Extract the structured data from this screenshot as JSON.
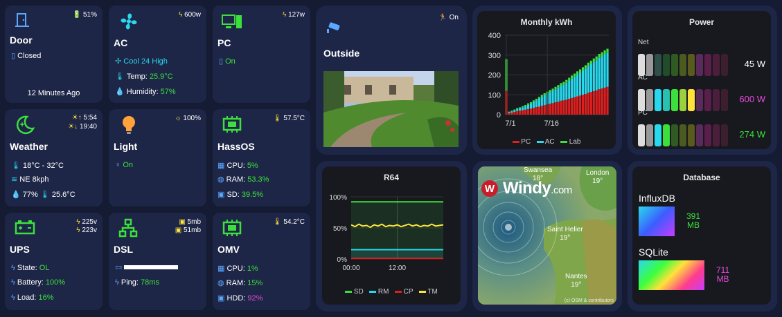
{
  "colors": {
    "bg": "#141b33",
    "card": "#1e2647",
    "green": "#3ce03c",
    "cyan": "#28d9ee",
    "magenta": "#e64bd9",
    "blue": "#5aa8ff",
    "yellow": "#ffe23a",
    "red": "#e01e1e"
  },
  "door": {
    "name": "Door",
    "battery": "51%",
    "state": "Closed",
    "ago": "12 Minutes Ago",
    "icon": "door-icon"
  },
  "ac": {
    "name": "AC",
    "power": "600w",
    "mode": "Cool 24 High",
    "temp_label": "Temp:",
    "temp": "25.9°C",
    "hum_label": "Humidity:",
    "hum": "57%",
    "icon": "fan-icon"
  },
  "pc": {
    "name": "PC",
    "power": "127w",
    "state": "On",
    "icon": "computer-icon"
  },
  "outside": {
    "name": "Outside",
    "motion": "On",
    "icon": "camera-icon"
  },
  "weather": {
    "name": "Weather",
    "sunrise": "5:54",
    "sunset": "19:40",
    "range": "18°C - 32°C",
    "wind": "NE 8kph",
    "hum": "77%",
    "dew": "25.6°C",
    "icon": "moon-star-icon"
  },
  "light": {
    "name": "Light",
    "brightness": "100%",
    "state": "On",
    "icon": "bulb-icon"
  },
  "hassos": {
    "name": "HassOS",
    "temp": "57.5°C",
    "cpu_label": "CPU:",
    "cpu": "5%",
    "ram_label": "RAM:",
    "ram": "53.3%",
    "sd_label": "SD:",
    "sd": "39.5%",
    "icon": "board-icon"
  },
  "ups": {
    "name": "UPS",
    "v1": "225v",
    "v2": "223v",
    "state_label": "State:",
    "state": "OL",
    "batt_label": "Battery:",
    "batt": "100%",
    "load_label": "Load:",
    "load": "16%",
    "icon": "battery-icon"
  },
  "dsl": {
    "name": "DSL",
    "up": "5mb",
    "down": "51mb",
    "ping_label": "Ping:",
    "ping": "78ms",
    "icon": "network-icon"
  },
  "omv": {
    "name": "OMV",
    "temp": "54.2°C",
    "cpu_label": "CPU:",
    "cpu": "1%",
    "ram_label": "RAM:",
    "ram": "15%",
    "hdd_label": "HDD:",
    "hdd": "92%",
    "icon": "board-icon"
  },
  "windy": {
    "brand": "Windy",
    "brand_suffix": ".com",
    "credit": "(c) OSM & contributors",
    "cities": [
      {
        "name": "Swansea",
        "temp": "18°"
      },
      {
        "name": "London",
        "temp": "19°"
      },
      {
        "name": "Saint Helier",
        "temp": "19°"
      },
      {
        "name": "Nantes",
        "temp": "19°"
      }
    ]
  },
  "power": {
    "title": "Power",
    "rows": [
      {
        "label": "Net",
        "value": "45 W"
      },
      {
        "label": "AC",
        "value": "600 W"
      },
      {
        "label": "PC",
        "value": "274 W"
      }
    ]
  },
  "database": {
    "title": "Database",
    "items": [
      {
        "label": "InfluxDB",
        "value": "391",
        "unit": "MB"
      },
      {
        "label": "SQLite",
        "value": "711",
        "unit": "MB"
      }
    ]
  },
  "chart_data": [
    {
      "type": "bar",
      "title": "Monthly kWh",
      "x_ticks": [
        "7/1",
        "7/16"
      ],
      "ylim": [
        0,
        400
      ],
      "y_ticks": [
        0,
        100,
        200,
        300,
        400
      ],
      "stacked": true,
      "legend_position": "bottom",
      "series": [
        {
          "name": "PC",
          "color": "#e01e1e",
          "values": [
            120,
            8,
            10,
            14,
            18,
            20,
            22,
            25,
            28,
            30,
            34,
            38,
            40,
            44,
            48,
            52,
            55,
            58,
            62,
            65,
            70,
            72,
            75,
            80,
            84,
            88,
            92,
            96,
            100,
            104,
            110,
            114,
            118,
            122,
            128,
            132,
            136,
            140
          ]
        },
        {
          "name": "AC",
          "color": "#28d9ee",
          "values": [
            0,
            4,
            6,
            8,
            10,
            12,
            15,
            18,
            22,
            26,
            30,
            34,
            40,
            46,
            50,
            54,
            58,
            62,
            66,
            72,
            76,
            80,
            86,
            92,
            98,
            104,
            110,
            116,
            122,
            128,
            134,
            140,
            146,
            152,
            158,
            162,
            168,
            172
          ]
        },
        {
          "name": "Lab",
          "color": "#3ce03c",
          "values": [
            160,
            3,
            4,
            4,
            5,
            5,
            6,
            6,
            7,
            7,
            8,
            8,
            9,
            9,
            10,
            10,
            11,
            11,
            12,
            12,
            13,
            13,
            14,
            14,
            15,
            15,
            16,
            16,
            17,
            17,
            18,
            18,
            19,
            19,
            20,
            20,
            20,
            20
          ]
        }
      ]
    },
    {
      "type": "line",
      "title": "R64",
      "x_ticks": [
        "00:00",
        "12:00"
      ],
      "y_ticks": [
        "0%",
        "50%",
        "100%"
      ],
      "ylim": [
        0,
        100
      ],
      "legend_position": "bottom",
      "series": [
        {
          "name": "SD",
          "color": "#3ce03c",
          "values": [
            92,
            92,
            92,
            92,
            92,
            92,
            92,
            92,
            92,
            92,
            92,
            92,
            92,
            92,
            92,
            92,
            92,
            92,
            92,
            92,
            92,
            92,
            92,
            92,
            92
          ]
        },
        {
          "name": "RM",
          "color": "#28d9ee",
          "values": [
            15,
            15,
            15,
            15,
            15,
            15,
            15,
            15,
            15,
            15,
            15,
            15,
            15,
            15,
            15,
            15,
            15,
            15,
            15,
            15,
            15,
            15,
            15,
            15,
            15
          ]
        },
        {
          "name": "CP",
          "color": "#e01e1e",
          "values": [
            1,
            1,
            1,
            1,
            1,
            1,
            1,
            1,
            1,
            1,
            1,
            1,
            1,
            1,
            1,
            1,
            1,
            1,
            1,
            1,
            1,
            1,
            1,
            1,
            1
          ]
        },
        {
          "name": "TM",
          "color": "#ffe23a",
          "values": [
            55,
            52,
            56,
            53,
            54,
            51,
            55,
            53,
            56,
            52,
            54,
            53,
            55,
            52,
            54,
            56,
            53,
            55,
            52,
            54,
            53,
            56,
            53,
            54,
            55
          ]
        }
      ]
    }
  ]
}
